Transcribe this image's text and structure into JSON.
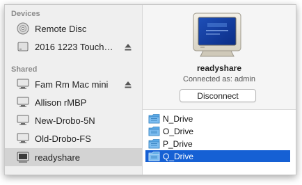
{
  "sidebar": {
    "devices_header": "Devices",
    "shared_header": "Shared",
    "devices": [
      {
        "label": "Remote Disc",
        "icon": "disc-icon"
      },
      {
        "label": "2016 1223 Touch…",
        "icon": "hard-drive-icon",
        "eject": true
      }
    ],
    "shared": [
      {
        "label": "Fam Rm Mac mini",
        "icon": "computer-icon",
        "eject": true
      },
      {
        "label": "Allison rMBP",
        "icon": "computer-icon"
      },
      {
        "label": "New-Drobo-5N",
        "icon": "computer-icon"
      },
      {
        "label": "Old-Drobo-FS",
        "icon": "computer-icon"
      },
      {
        "label": "readyshare",
        "icon": "monitor-icon",
        "selected": true
      }
    ]
  },
  "detail": {
    "server_name": "readyshare",
    "connected_as": "Connected as: admin",
    "disconnect_label": "Disconnect"
  },
  "files": [
    {
      "name": "N_Drive"
    },
    {
      "name": "O_Drive"
    },
    {
      "name": "P_Drive"
    },
    {
      "name": "Q_Drive",
      "selected": true
    }
  ],
  "colors": {
    "selection_blue": "#1560d4",
    "folder_blue": "#5aa9e6",
    "sidebar_bg": "#efefef"
  }
}
